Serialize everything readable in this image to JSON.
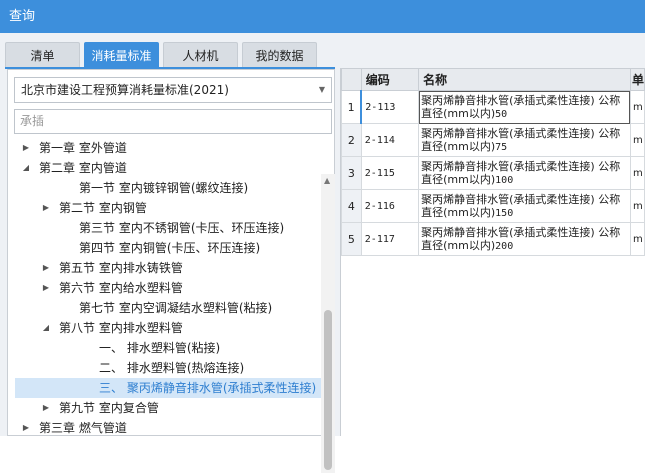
{
  "window": {
    "title": "查询"
  },
  "tabs": [
    {
      "label": "清单"
    },
    {
      "label": "消耗量标准"
    },
    {
      "label": "人材机"
    },
    {
      "label": "我的数据"
    }
  ],
  "left_panel": {
    "standard_select": {
      "value": "北京市建设工程预算消耗量标准(2021)"
    },
    "search": {
      "placeholder": "承插"
    },
    "tree": [
      {
        "label": "第一章 室外管道",
        "expand": "collapsed"
      },
      {
        "label": "第二章 室内管道",
        "expand": "expanded"
      },
      {
        "label": "第一节 室内镀锌钢管(螺纹连接)",
        "expand": "none"
      },
      {
        "label": "第二节 室内钢管",
        "expand": "collapsed"
      },
      {
        "label": "第三节 室内不锈钢管(卡压、环压连接)",
        "expand": "none"
      },
      {
        "label": "第四节 室内铜管(卡压、环压连接)",
        "expand": "none"
      },
      {
        "label": "第五节 室内排水铸铁管",
        "expand": "collapsed"
      },
      {
        "label": "第六节 室内给水塑料管",
        "expand": "collapsed"
      },
      {
        "label": "第七节 室内空调凝结水塑料管(粘接)",
        "expand": "none"
      },
      {
        "label": "第八节 室内排水塑料管",
        "expand": "expanded"
      },
      {
        "label": "一、 排水塑料管(粘接)",
        "expand": "none"
      },
      {
        "label": "二、 排水塑料管(热熔连接)",
        "expand": "none"
      },
      {
        "label": "三、 聚丙烯静音排水管(承插式柔性连接)",
        "expand": "none",
        "selected": true
      },
      {
        "label": "第九节 室内复合管",
        "expand": "collapsed"
      },
      {
        "label": "第三章 燃气管道",
        "expand": "collapsed"
      }
    ]
  },
  "grid": {
    "columns": [
      {
        "label": ""
      },
      {
        "label": "编码"
      },
      {
        "label": "名称"
      },
      {
        "label": "单"
      }
    ],
    "rows": [
      {
        "num": "1",
        "code": "2-113",
        "name_main": "聚丙烯静音排水管(承插式柔性连接) 公称直径(mm以内)",
        "name_size": "50",
        "unit": "m"
      },
      {
        "num": "2",
        "code": "2-114",
        "name_main": "聚丙烯静音排水管(承插式柔性连接) 公称直径(mm以内)",
        "name_size": "75",
        "unit": "m"
      },
      {
        "num": "3",
        "code": "2-115",
        "name_main": "聚丙烯静音排水管(承插式柔性连接) 公称直径(mm以内)",
        "name_size": "100",
        "unit": "m"
      },
      {
        "num": "4",
        "code": "2-116",
        "name_main": "聚丙烯静音排水管(承插式柔性连接) 公称直径(mm以内)",
        "name_size": "150",
        "unit": "m"
      },
      {
        "num": "5",
        "code": "2-117",
        "name_main": "聚丙烯静音排水管(承插式柔性连接) 公称直径(mm以内)",
        "name_size": "200",
        "unit": "m"
      }
    ]
  },
  "colors": {
    "accent": "#3d8fdc",
    "selected_bg": "#d3e6f8",
    "selected_text": "#2f7fd0"
  }
}
